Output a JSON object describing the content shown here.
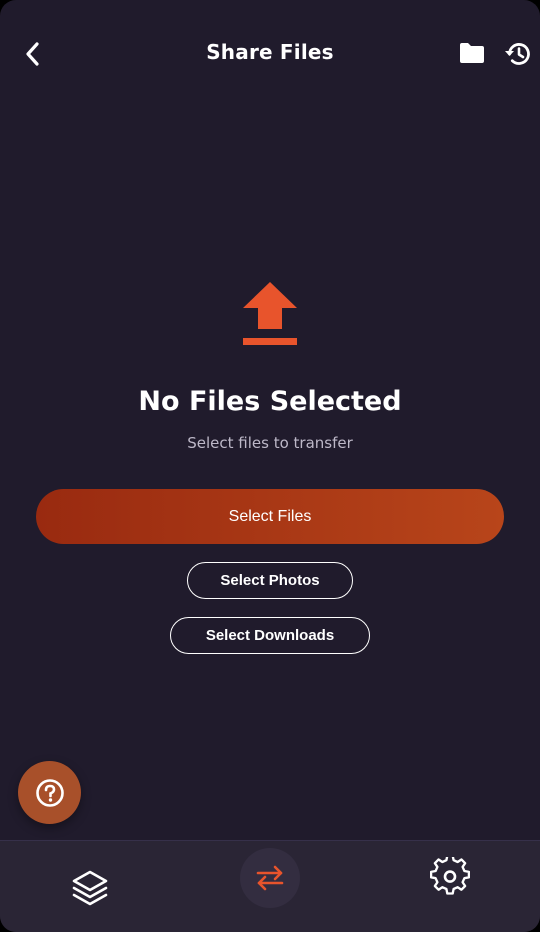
{
  "header": {
    "title": "Share Files",
    "back_icon": "chevron-left-icon",
    "folder_icon": "folder-icon",
    "history_icon": "history-icon"
  },
  "empty_state": {
    "icon": "upload-icon",
    "title": "No Files Selected",
    "subtitle": "Select files to transfer"
  },
  "actions": {
    "select_files": "Select Files",
    "select_photos": "Select Photos",
    "select_downloads": "Select Downloads"
  },
  "help": {
    "icon": "help-icon"
  },
  "bottom_nav": {
    "items": [
      {
        "icon": "layers-icon",
        "active": false
      },
      {
        "icon": "transfer-icon",
        "active": true
      },
      {
        "icon": "gear-icon",
        "active": false
      }
    ]
  },
  "colors": {
    "background": "#201b2c",
    "accent": "#e8542c",
    "button_gradient_start": "#992a10",
    "button_gradient_end": "#b8451a",
    "help_fab": "#a8502a",
    "nav_background": "#2a2535"
  }
}
